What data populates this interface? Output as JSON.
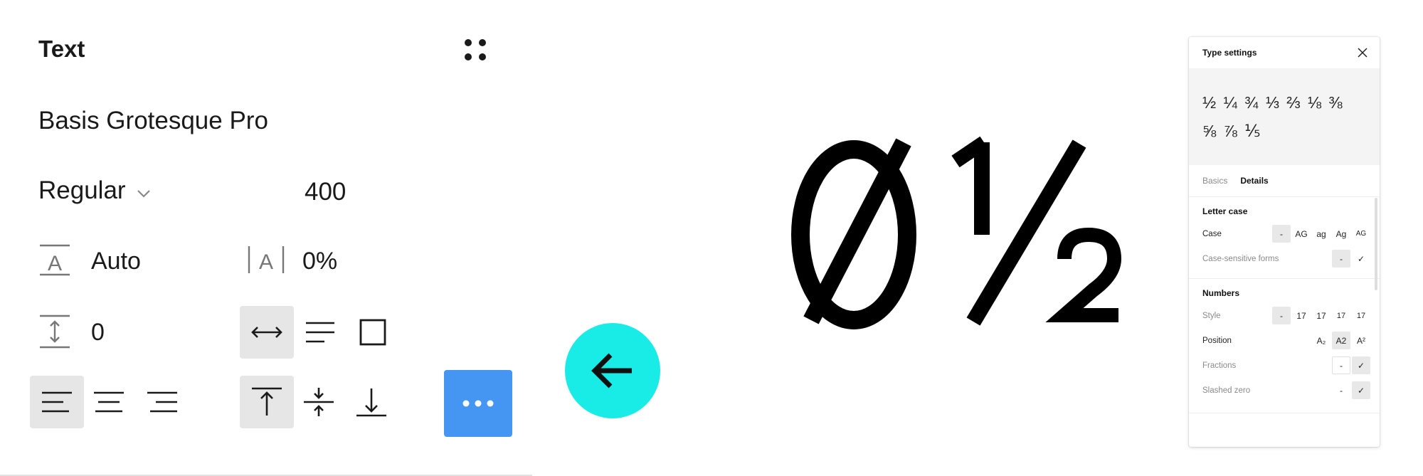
{
  "text_panel": {
    "title": "Text",
    "font_family": "Basis Grotesque Pro",
    "font_style": "Regular",
    "font_weight": "400",
    "line_height": "Auto",
    "letter_spacing": "0%",
    "paragraph_spacing": "0"
  },
  "preview": {
    "glyph": "0½"
  },
  "type_settings": {
    "title": "Type settings",
    "fractions_line1": "½ ¼ ¾ ⅓ ⅔ ⅛ ⅜",
    "fractions_line2": "⅝ ⅞ ⅕",
    "tabs": {
      "basics": "Basics",
      "details": "Details"
    },
    "letter_case": {
      "title": "Letter case",
      "case_label": "Case",
      "case_options": [
        "-",
        "AG",
        "ag",
        "Ag",
        "AG"
      ],
      "case_sensitive_label": "Case-sensitive forms",
      "case_sensitive_options": [
        "-",
        "✓"
      ]
    },
    "numbers": {
      "title": "Numbers",
      "style_label": "Style",
      "style_options": [
        "-",
        "17",
        "17",
        "17",
        "17"
      ],
      "position_label": "Position",
      "position_options": [
        "A₂",
        "A2",
        "A²"
      ],
      "fractions_label": "Fractions",
      "fractions_options": [
        "-",
        "✓"
      ],
      "slashed_zero_label": "Slashed zero",
      "slashed_zero_options": [
        "-",
        "✓"
      ]
    }
  },
  "colors": {
    "more_button": "#4496f2",
    "back_button": "#19ece6",
    "active_bg": "#e6e6e6"
  }
}
